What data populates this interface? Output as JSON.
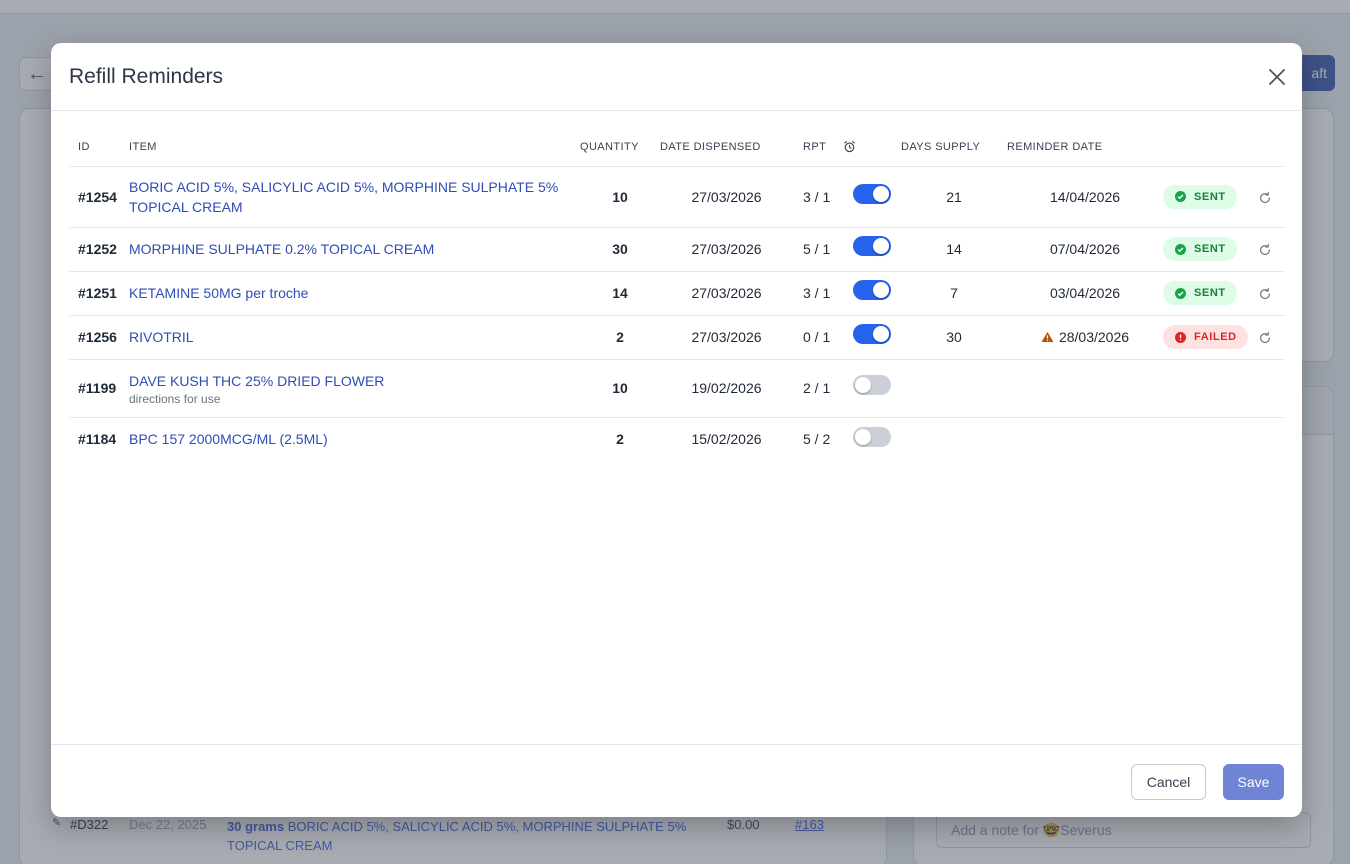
{
  "background": {
    "draft_button_label": "aft",
    "row": {
      "id": "#D322",
      "date": "Dec 22, 2025",
      "quantity": "30 grams",
      "description": "BORIC ACID 5%, SALICYLIC ACID 5%, MORPHINE SULPHATE 5% TOPICAL CREAM",
      "price": "$0.00",
      "ref": "#163"
    },
    "note_placeholder": "Add a note for 🤓Severus"
  },
  "modal": {
    "title": "Refill Reminders",
    "columns": {
      "id": "ID",
      "item": "ITEM",
      "quantity": "QUANTITY",
      "date_dispensed": "DATE DISPENSED",
      "rpt": "RPT",
      "days_supply": "DAYS SUPPLY",
      "reminder_date": "REMINDER DATE"
    },
    "rows": [
      {
        "id": "#1254",
        "item": "BORIC ACID 5%, SALICYLIC ACID 5%, MORPHINE SULPHATE 5% TOPICAL CREAM",
        "sub": "",
        "quantity": "10",
        "date_dispensed": "27/03/2026",
        "rpt": "3 / 1",
        "reminder_on": true,
        "days_supply": "21",
        "reminder_date": "14/04/2026",
        "warning": false,
        "status": "SENT"
      },
      {
        "id": "#1252",
        "item": "MORPHINE SULPHATE 0.2% TOPICAL CREAM",
        "sub": "",
        "quantity": "30",
        "date_dispensed": "27/03/2026",
        "rpt": "5 / 1",
        "reminder_on": true,
        "days_supply": "14",
        "reminder_date": "07/04/2026",
        "warning": false,
        "status": "SENT"
      },
      {
        "id": "#1251",
        "item": "KETAMINE 50MG per troche",
        "sub": "",
        "quantity": "14",
        "date_dispensed": "27/03/2026",
        "rpt": "3 / 1",
        "reminder_on": true,
        "days_supply": "7",
        "reminder_date": "03/04/2026",
        "warning": false,
        "status": "SENT"
      },
      {
        "id": "#1256",
        "item": "RIVOTRIL",
        "sub": "",
        "quantity": "2",
        "date_dispensed": "27/03/2026",
        "rpt": "0 / 1",
        "reminder_on": true,
        "days_supply": "30",
        "reminder_date": "28/03/2026",
        "warning": true,
        "status": "FAILED"
      },
      {
        "id": "#1199",
        "item": "DAVE KUSH THC 25% DRIED FLOWER",
        "sub": "directions for use",
        "quantity": "10",
        "date_dispensed": "19/02/2026",
        "rpt": "2 / 1",
        "reminder_on": false,
        "days_supply": "",
        "reminder_date": "",
        "warning": false,
        "status": ""
      },
      {
        "id": "#1184",
        "item": "BPC 157 2000MCG/ML (2.5ML)",
        "sub": "",
        "quantity": "2",
        "date_dispensed": "15/02/2026",
        "rpt": "5 / 2",
        "reminder_on": false,
        "days_supply": "",
        "reminder_date": "",
        "warning": false,
        "status": ""
      }
    ],
    "footer": {
      "cancel_label": "Cancel",
      "save_label": "Save"
    },
    "icons": {
      "close": "close-icon",
      "alarm": "alarm-clock-icon",
      "refresh": "refresh-icon",
      "sent": "check-circle-icon",
      "failed": "alert-circle-icon",
      "warning": "warning-triangle-icon"
    },
    "colors": {
      "accent": "#2563eb",
      "link": "#2e4db7",
      "sent_bg": "#dcfce7",
      "sent_fg": "#15803d",
      "failed_bg": "#fee2e2",
      "failed_fg": "#dc2626",
      "warning": "#b45309",
      "save_button": "#6f84d4"
    }
  }
}
